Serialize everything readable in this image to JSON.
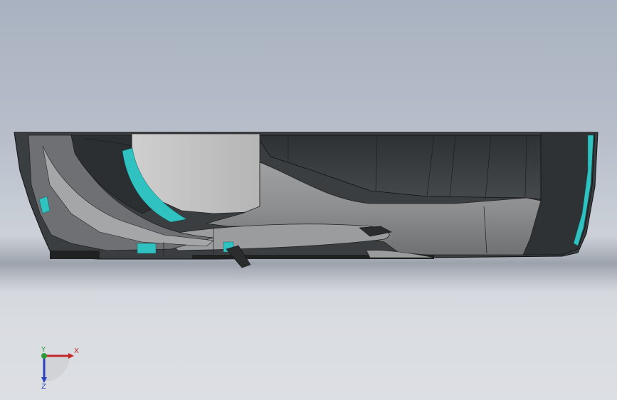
{
  "triad": {
    "x_label": "X",
    "y_label": "Y",
    "z_label": "Z",
    "x_color": "#c0282a",
    "y_color": "#2f9a3a",
    "z_color": "#2a3fbf"
  },
  "colors": {
    "accent_teal": "#2fc2c0",
    "body_dark": "#3a3d40",
    "body_mid": "#8a8c8e",
    "body_light": "#c7c7c7"
  }
}
